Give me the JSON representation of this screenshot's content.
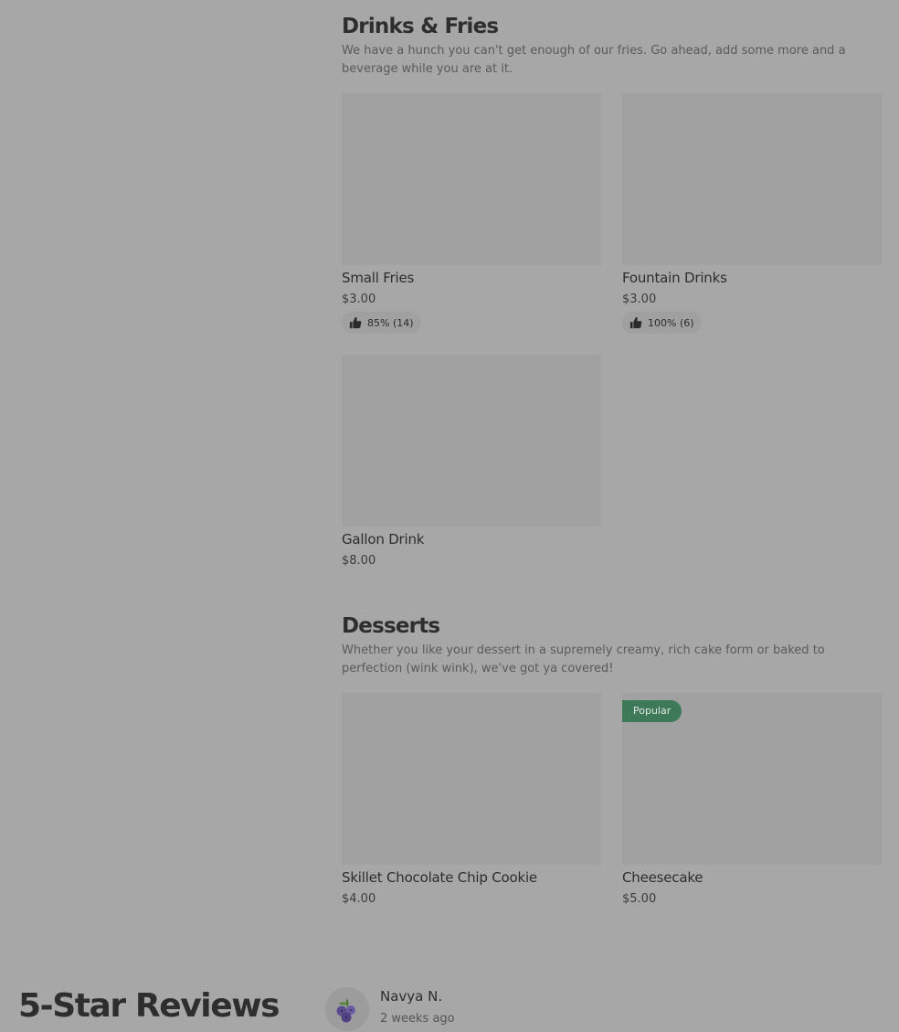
{
  "colors": {
    "overlay_background": "#a7a7a7",
    "image_placeholder": "#a1a1a1",
    "popular_badge": "#3e7a59",
    "heading_text": "#2e2e2e",
    "muted_text": "#5a5a5a"
  },
  "sections": [
    {
      "title": "Drinks & Fries",
      "description": "We have a hunch you can't get enough of our fries. Go ahead, add some more and a beverage while you are at it.",
      "items": [
        {
          "name": "Small Fries",
          "price": "$3.00",
          "rating": "85% (14)",
          "rating_icon": "thumbs-up-icon"
        },
        {
          "name": "Fountain Drinks",
          "price": "$3.00",
          "rating": "100% (6)",
          "rating_icon": "thumbs-up-icon"
        },
        {
          "name": "Gallon Drink",
          "price": "$8.00"
        }
      ]
    },
    {
      "title": "Desserts",
      "description": "Whether you like your dessert in a supremely creamy, rich cake form or baked to perfection (wink wink), we've got ya covered!",
      "items": [
        {
          "name": "Skillet Chocolate Chip Cookie",
          "price": "$4.00"
        },
        {
          "name": "Cheesecake",
          "price": "$5.00",
          "badge": "Popular"
        }
      ]
    }
  ],
  "reviews": {
    "title": "5-Star Reviews",
    "items": [
      {
        "author": "Navya N.",
        "time": "2 weeks ago",
        "avatar_icon": "blueberry-avatar-icon"
      }
    ]
  }
}
